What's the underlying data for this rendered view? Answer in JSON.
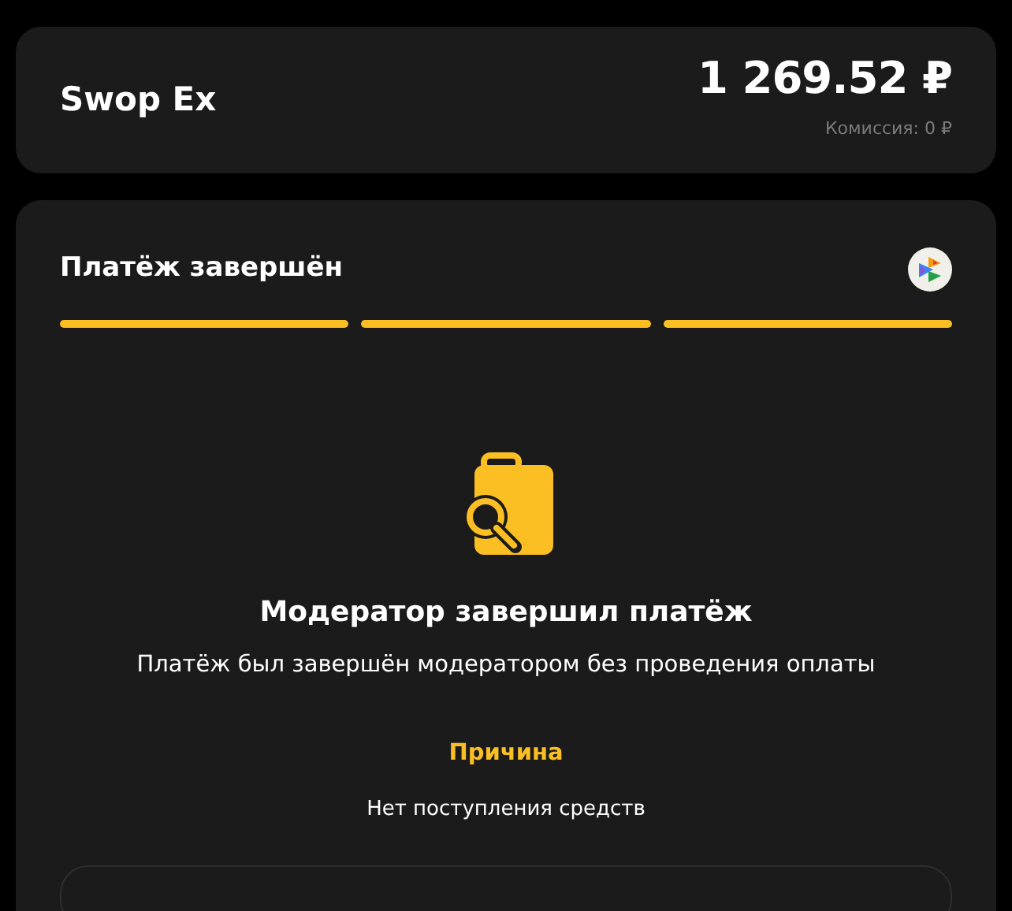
{
  "header": {
    "merchant": "Swop Ex",
    "amount": "1 269.52 ₽",
    "commission": "Комиссия: 0 ₽"
  },
  "payment": {
    "title": "Платёж завершён",
    "steps": [
      {
        "done": true
      },
      {
        "done": true
      },
      {
        "done": true
      }
    ],
    "heading": "Модератор завершил платёж",
    "description": "Платёж был завершён модератором без проведения оплаты",
    "reason_label": "Причина",
    "reason": "Нет поступления средств"
  }
}
